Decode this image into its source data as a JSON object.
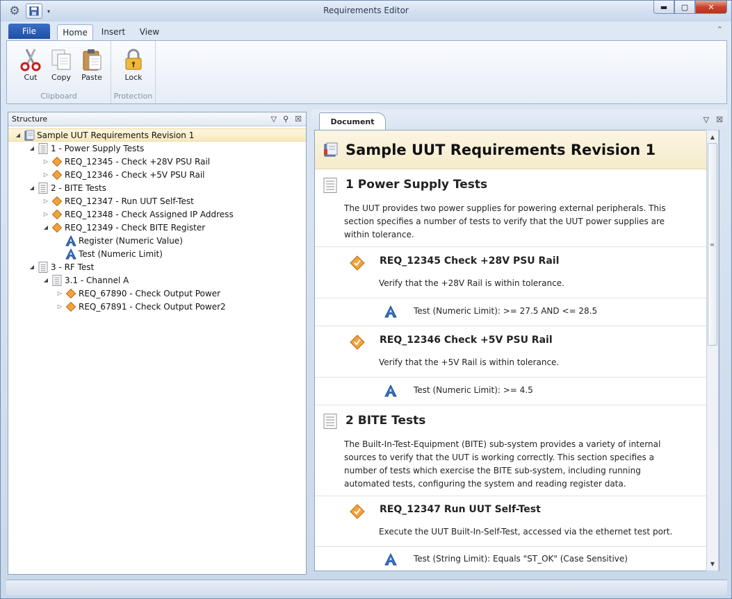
{
  "window": {
    "title": "Requirements Editor"
  },
  "ribbon": {
    "file_label": "File",
    "tabs": [
      "Home",
      "Insert",
      "View"
    ],
    "groups": [
      {
        "label": "Clipboard",
        "buttons": [
          "Cut",
          "Copy",
          "Paste"
        ]
      },
      {
        "label": "Protection",
        "buttons": [
          "Lock"
        ]
      }
    ]
  },
  "structure": {
    "title": "Structure",
    "items": [
      "Sample UUT Requirements Revision 1",
      "1 - Power Supply Tests",
      "REQ_12345 - Check +28V PSU Rail",
      "REQ_12346 - Check +5V PSU Rail",
      "2 - BITE Tests",
      "REQ_12347 - Run UUT Self-Test",
      "REQ_12348 - Check Assigned IP Address",
      "REQ_12349 - Check BITE Register",
      "Register (Numeric Value)",
      "Test (Numeric Limit)",
      "3 - RF Test",
      "3.1 - Channel A",
      "REQ_67890 - Check Output Power",
      "REQ_67891 - Check Output Power2"
    ]
  },
  "document": {
    "tab": "Document",
    "title": "Sample UUT Requirements Revision 1",
    "s1": {
      "title": "1  Power Supply Tests",
      "text": "The UUT provides two power supplies for powering external peripherals. This section specifies a number of tests to verify that the UUT power supplies are within tolerance."
    },
    "r1": {
      "title": "REQ_12345  Check +28V PSU Rail",
      "desc": "Verify that the +28V Rail is within tolerance.",
      "test": "Test (Numeric Limit):  >= 27.5 AND <= 28.5"
    },
    "r2": {
      "title": "REQ_12346  Check +5V PSU Rail",
      "desc": "Verify that the +5V Rail is within tolerance.",
      "test": "Test (Numeric Limit):  >= 4.5"
    },
    "s2": {
      "title": "2  BITE Tests",
      "text": "The Built-In-Test-Equipment (BITE) sub-system provides a variety of internal sources to verify that the UUT is working correctly. This section specifies a number of tests which exercise the BITE sub-system, including running automated tests, configuring the system and reading register data."
    },
    "r3": {
      "title": "REQ_12347  Run UUT Self-Test",
      "desc": "Execute the UUT Built-In-Self-Test, accessed via the ethernet test port.",
      "test": "Test (String Limit):  Equals \"ST_OK\" (Case Sensitive)"
    }
  }
}
